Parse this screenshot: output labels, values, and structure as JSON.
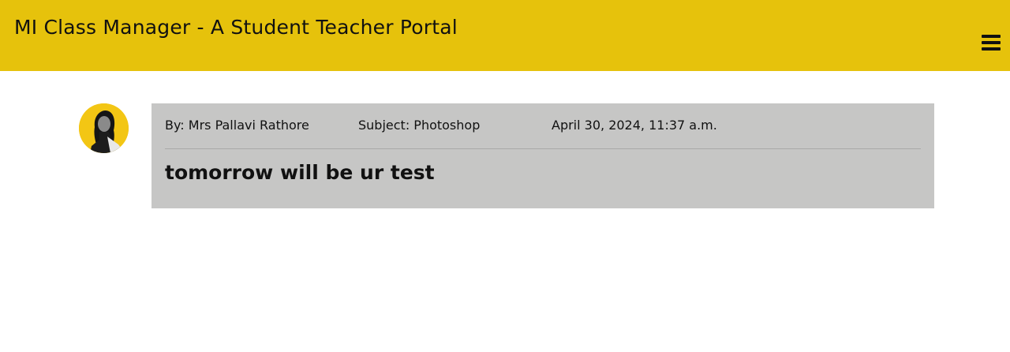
{
  "header": {
    "title": "MI Class Manager - A Student Teacher Portal",
    "menu_icon": "hamburger-menu-icon",
    "background_color": "#e6c20c"
  },
  "post": {
    "avatar_alt": "Mrs Pallavi Rathore",
    "author": "By: Mrs Pallavi Rathore",
    "subject": "Subject: Photoshop",
    "date": "April 30, 2024, 11:37 a.m.",
    "message": "tomorrow will be ur test",
    "card_color": "#c6c6c5"
  }
}
